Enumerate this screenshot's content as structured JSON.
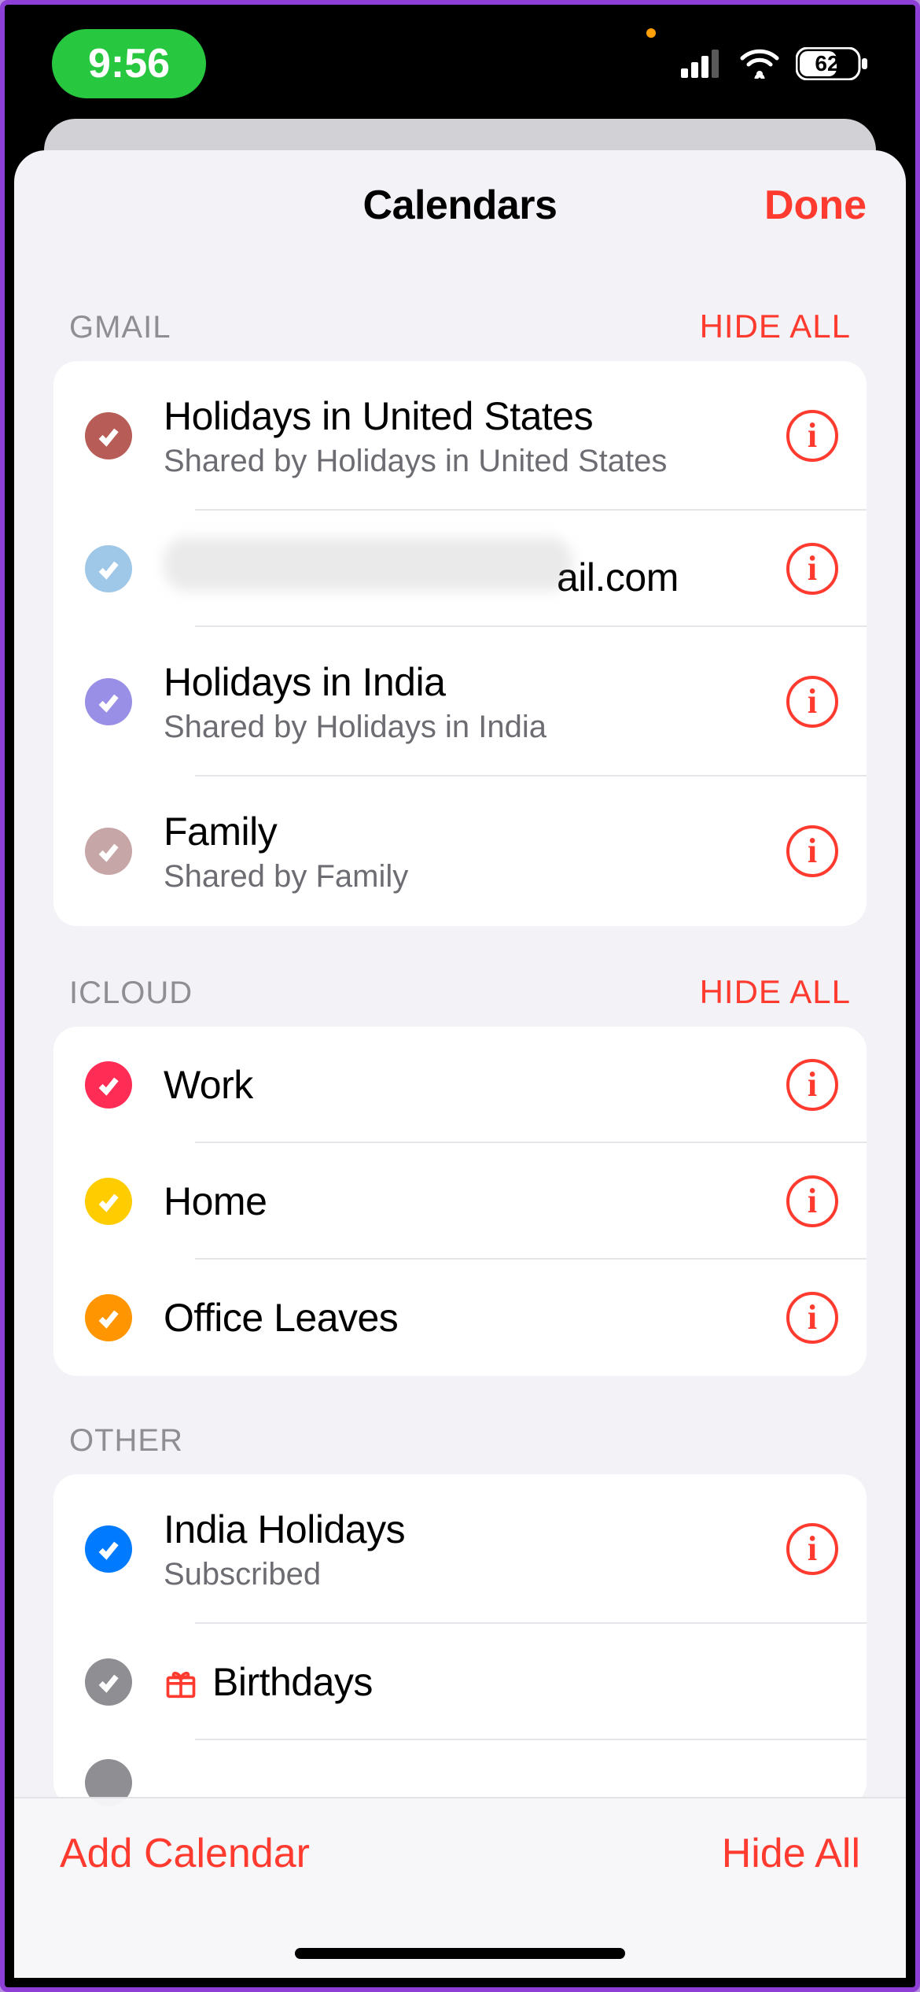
{
  "status": {
    "time": "9:56",
    "battery": "62"
  },
  "sheet": {
    "title": "Calendars",
    "done": "Done"
  },
  "sections": [
    {
      "title": "GMAIL",
      "action": "HIDE ALL",
      "items": [
        {
          "name": "Holidays in United States",
          "sub": "Shared by Holidays in United States",
          "color": "#b85c57",
          "info": true
        },
        {
          "name_blurred_suffix": "ail.com",
          "color": "#9fc7e8",
          "info": true
        },
        {
          "name": "Holidays in India",
          "sub": "Shared by Holidays in India",
          "color": "#9a8fe6",
          "info": true
        },
        {
          "name": "Family",
          "sub": "Shared by Family",
          "color": "#c6a6a6",
          "info": true
        }
      ]
    },
    {
      "title": "ICLOUD",
      "action": "HIDE ALL",
      "items": [
        {
          "name": "Work",
          "color": "#ff2d55",
          "info": true
        },
        {
          "name": "Home",
          "color": "#ffcc00",
          "info": true
        },
        {
          "name": "Office Leaves",
          "color": "#ff9500",
          "info": true
        }
      ]
    },
    {
      "title": "OTHER",
      "items": [
        {
          "name": "India Holidays",
          "sub": "Subscribed",
          "color": "#007aff",
          "info": true
        },
        {
          "name": "Birthdays",
          "color": "#8e8e93",
          "icon": "gift",
          "info": false
        }
      ]
    }
  ],
  "toolbar": {
    "add": "Add Calendar",
    "hideAll": "Hide All"
  }
}
